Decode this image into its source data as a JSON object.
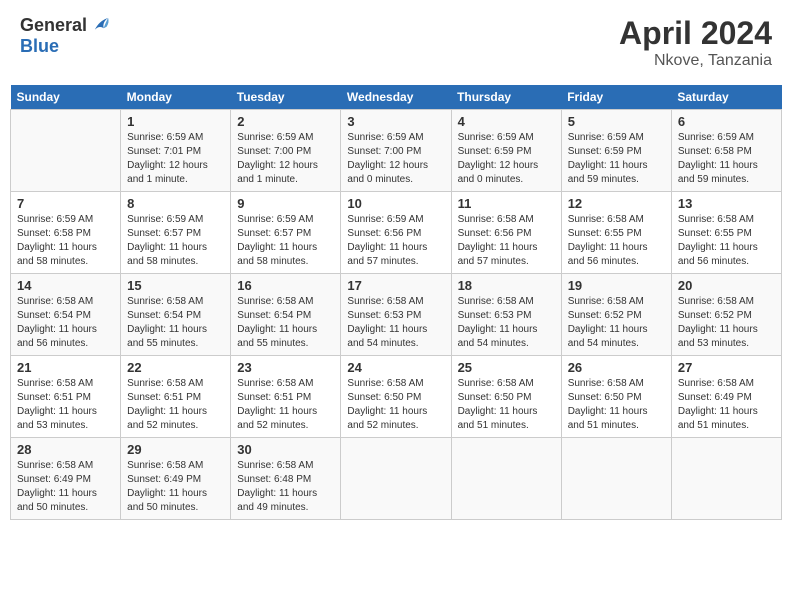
{
  "header": {
    "logo_general": "General",
    "logo_blue": "Blue",
    "month": "April 2024",
    "location": "Nkove, Tanzania"
  },
  "days_of_week": [
    "Sunday",
    "Monday",
    "Tuesday",
    "Wednesday",
    "Thursday",
    "Friday",
    "Saturday"
  ],
  "weeks": [
    [
      {
        "day": "",
        "info": ""
      },
      {
        "day": "1",
        "info": "Sunrise: 6:59 AM\nSunset: 7:01 PM\nDaylight: 12 hours\nand 1 minute."
      },
      {
        "day": "2",
        "info": "Sunrise: 6:59 AM\nSunset: 7:00 PM\nDaylight: 12 hours\nand 1 minute."
      },
      {
        "day": "3",
        "info": "Sunrise: 6:59 AM\nSunset: 7:00 PM\nDaylight: 12 hours\nand 0 minutes."
      },
      {
        "day": "4",
        "info": "Sunrise: 6:59 AM\nSunset: 6:59 PM\nDaylight: 12 hours\nand 0 minutes."
      },
      {
        "day": "5",
        "info": "Sunrise: 6:59 AM\nSunset: 6:59 PM\nDaylight: 11 hours\nand 59 minutes."
      },
      {
        "day": "6",
        "info": "Sunrise: 6:59 AM\nSunset: 6:58 PM\nDaylight: 11 hours\nand 59 minutes."
      }
    ],
    [
      {
        "day": "7",
        "info": "Sunrise: 6:59 AM\nSunset: 6:58 PM\nDaylight: 11 hours\nand 58 minutes."
      },
      {
        "day": "8",
        "info": "Sunrise: 6:59 AM\nSunset: 6:57 PM\nDaylight: 11 hours\nand 58 minutes."
      },
      {
        "day": "9",
        "info": "Sunrise: 6:59 AM\nSunset: 6:57 PM\nDaylight: 11 hours\nand 58 minutes."
      },
      {
        "day": "10",
        "info": "Sunrise: 6:59 AM\nSunset: 6:56 PM\nDaylight: 11 hours\nand 57 minutes."
      },
      {
        "day": "11",
        "info": "Sunrise: 6:58 AM\nSunset: 6:56 PM\nDaylight: 11 hours\nand 57 minutes."
      },
      {
        "day": "12",
        "info": "Sunrise: 6:58 AM\nSunset: 6:55 PM\nDaylight: 11 hours\nand 56 minutes."
      },
      {
        "day": "13",
        "info": "Sunrise: 6:58 AM\nSunset: 6:55 PM\nDaylight: 11 hours\nand 56 minutes."
      }
    ],
    [
      {
        "day": "14",
        "info": "Sunrise: 6:58 AM\nSunset: 6:54 PM\nDaylight: 11 hours\nand 56 minutes."
      },
      {
        "day": "15",
        "info": "Sunrise: 6:58 AM\nSunset: 6:54 PM\nDaylight: 11 hours\nand 55 minutes."
      },
      {
        "day": "16",
        "info": "Sunrise: 6:58 AM\nSunset: 6:54 PM\nDaylight: 11 hours\nand 55 minutes."
      },
      {
        "day": "17",
        "info": "Sunrise: 6:58 AM\nSunset: 6:53 PM\nDaylight: 11 hours\nand 54 minutes."
      },
      {
        "day": "18",
        "info": "Sunrise: 6:58 AM\nSunset: 6:53 PM\nDaylight: 11 hours\nand 54 minutes."
      },
      {
        "day": "19",
        "info": "Sunrise: 6:58 AM\nSunset: 6:52 PM\nDaylight: 11 hours\nand 54 minutes."
      },
      {
        "day": "20",
        "info": "Sunrise: 6:58 AM\nSunset: 6:52 PM\nDaylight: 11 hours\nand 53 minutes."
      }
    ],
    [
      {
        "day": "21",
        "info": "Sunrise: 6:58 AM\nSunset: 6:51 PM\nDaylight: 11 hours\nand 53 minutes."
      },
      {
        "day": "22",
        "info": "Sunrise: 6:58 AM\nSunset: 6:51 PM\nDaylight: 11 hours\nand 52 minutes."
      },
      {
        "day": "23",
        "info": "Sunrise: 6:58 AM\nSunset: 6:51 PM\nDaylight: 11 hours\nand 52 minutes."
      },
      {
        "day": "24",
        "info": "Sunrise: 6:58 AM\nSunset: 6:50 PM\nDaylight: 11 hours\nand 52 minutes."
      },
      {
        "day": "25",
        "info": "Sunrise: 6:58 AM\nSunset: 6:50 PM\nDaylight: 11 hours\nand 51 minutes."
      },
      {
        "day": "26",
        "info": "Sunrise: 6:58 AM\nSunset: 6:50 PM\nDaylight: 11 hours\nand 51 minutes."
      },
      {
        "day": "27",
        "info": "Sunrise: 6:58 AM\nSunset: 6:49 PM\nDaylight: 11 hours\nand 51 minutes."
      }
    ],
    [
      {
        "day": "28",
        "info": "Sunrise: 6:58 AM\nSunset: 6:49 PM\nDaylight: 11 hours\nand 50 minutes."
      },
      {
        "day": "29",
        "info": "Sunrise: 6:58 AM\nSunset: 6:49 PM\nDaylight: 11 hours\nand 50 minutes."
      },
      {
        "day": "30",
        "info": "Sunrise: 6:58 AM\nSunset: 6:48 PM\nDaylight: 11 hours\nand 49 minutes."
      },
      {
        "day": "",
        "info": ""
      },
      {
        "day": "",
        "info": ""
      },
      {
        "day": "",
        "info": ""
      },
      {
        "day": "",
        "info": ""
      }
    ]
  ]
}
